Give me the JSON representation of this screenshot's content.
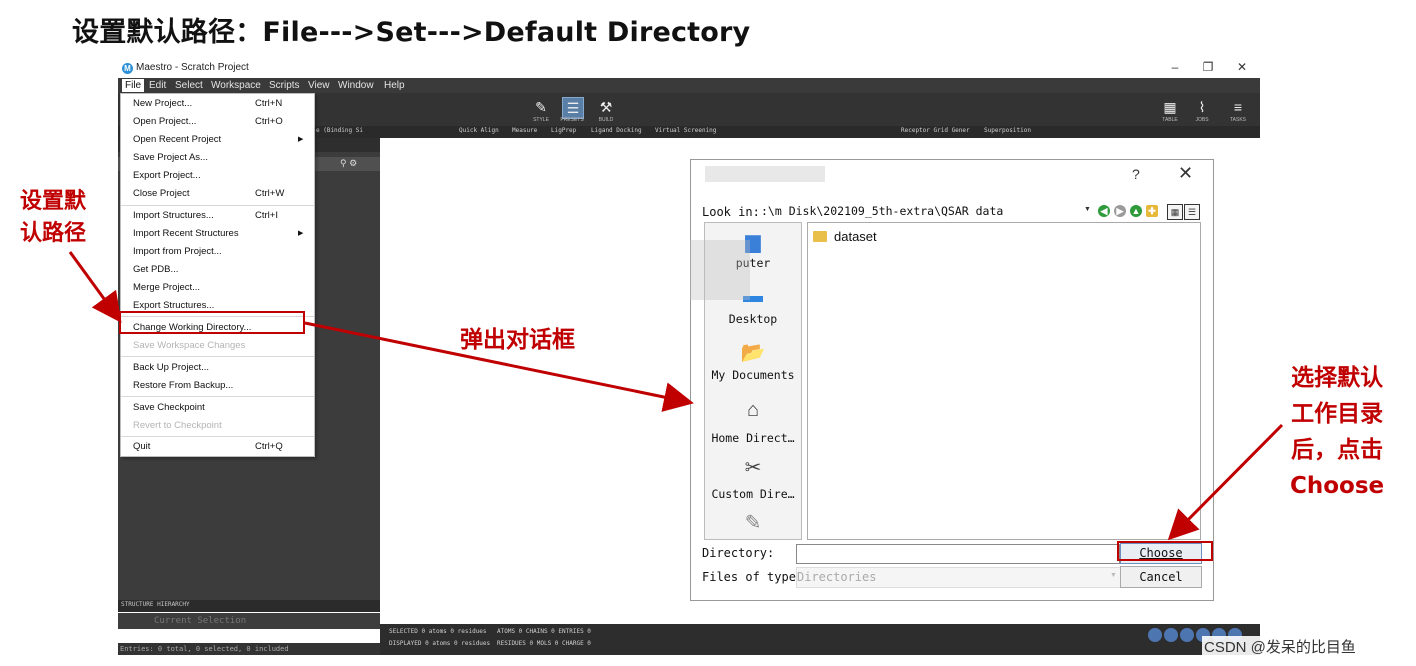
{
  "slide": {
    "heading": "设置默认路径：File--->Set--->Default Directory"
  },
  "window": {
    "title": "Maestro - Scratch Project",
    "controls": {
      "minimize": "–",
      "restore": "❐",
      "close": "✕"
    }
  },
  "menubar": [
    "File",
    "Edit",
    "Select",
    "Workspace",
    "Scripts",
    "View",
    "Window",
    "Help"
  ],
  "toolbar": {
    "buttons": [
      {
        "icon": "style-icon",
        "caption": "STYLE"
      },
      {
        "icon": "presets-icon",
        "caption": "PRESETS"
      },
      {
        "icon": "build-icon",
        "caption": "BUILD"
      },
      {
        "icon": "table-icon",
        "caption": "TABLE"
      },
      {
        "icon": "jobs-icon",
        "caption": "JOBS"
      },
      {
        "icon": "tasks-icon",
        "caption": "TASKS"
      }
    ],
    "strip": [
      "e (Binding Si",
      "Quick Align",
      "Measure",
      "LigPrep",
      "Ligand Docking",
      "Virtual Screening",
      "Receptor Grid Gener",
      "Superposition"
    ]
  },
  "file_menu": {
    "items": [
      {
        "label": "New Project...",
        "shortcut": "Ctrl+N"
      },
      {
        "label": "Open Project...",
        "shortcut": "Ctrl+O"
      },
      {
        "label": "Open Recent Project",
        "submenu": true
      },
      {
        "label": "Save Project As..."
      },
      {
        "label": "Export Project..."
      },
      {
        "label": "Close Project",
        "shortcut": "Ctrl+W"
      },
      {
        "label": "Import Structures...",
        "shortcut": "Ctrl+I"
      },
      {
        "label": "Import Recent Structures",
        "submenu": true
      },
      {
        "label": "Import from Project..."
      },
      {
        "label": "Get PDB..."
      },
      {
        "label": "Merge Project..."
      },
      {
        "label": "Export Structures..."
      },
      {
        "label": "Change Working Directory..."
      },
      {
        "label": "Save Workspace Changes",
        "disabled": true
      },
      {
        "label": "Back Up Project..."
      },
      {
        "label": "Restore From Backup..."
      },
      {
        "label": "Save Checkpoint"
      },
      {
        "label": "Revert to Checkpoint",
        "disabled": true
      },
      {
        "label": "Quit",
        "shortcut": "Ctrl+Q"
      }
    ]
  },
  "left_panel": {
    "hierarchy_title": "STRUCTURE HIERARCHY",
    "current_selection": "Current Selection",
    "entries": "Entries: 0 total, 0 selected, 0 included"
  },
  "statusbar": {
    "selected": "SELECTED 0 atoms  0 residues",
    "displayed": "DISPLAYED 0 atoms  0 residues",
    "atoms": "ATOMS 0  CHAINS 0  ENTRIES 0",
    "residues": "RESIDUES 0  MOLS 0  CHARGE 0"
  },
  "dialog": {
    "help": "?",
    "close": "✕",
    "look_in_label": "Look in:",
    "look_in_value": ":\\m Disk\\202109_5th-extra\\QSAR data",
    "sidebar": [
      {
        "icon": "computer-icon",
        "label": "puter"
      },
      {
        "icon": "desktop-icon",
        "label": "Desktop"
      },
      {
        "icon": "documents-icon",
        "label": "My Documents"
      },
      {
        "icon": "home-icon",
        "label": "Home Direct…"
      },
      {
        "icon": "custom-dir-icon",
        "label": "Custom Dire…"
      }
    ],
    "files": [
      "dataset"
    ],
    "directory_label": "Directory:",
    "directory_value": "",
    "filetype_label": "Files of type:",
    "filetype_value": "Directories",
    "choose_label": "Choose",
    "cancel_label": "Cancel"
  },
  "annotations": {
    "left": [
      "设置默",
      "认路径"
    ],
    "middle": "弹出对话框",
    "right": [
      "选择默认",
      "工作目录",
      "后，点击",
      "Choose"
    ]
  },
  "watermark": "CSDN @发呆的比目鱼",
  "colors": {
    "annotation_red": "#c00000",
    "menubar_bg": "#3a3a3a",
    "choose_border": "#6b8fc0"
  }
}
